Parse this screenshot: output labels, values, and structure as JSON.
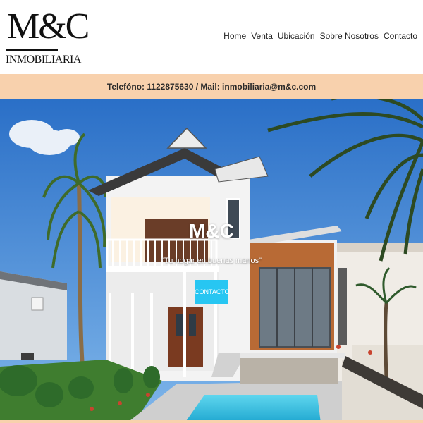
{
  "logo": {
    "mark": "M&C",
    "subtitle": "INMOBILIARIA"
  },
  "nav": {
    "items": [
      "Home",
      "Venta",
      "Ubicación",
      "Sobre Nosotros",
      "Contacto"
    ]
  },
  "infobar": {
    "text": "Telefóno: 1122875630 / Mail: inmobiliaria@m&c.com"
  },
  "hero": {
    "title": "M&C",
    "tagline": "\"Tu hogar en buenas manos\"",
    "button_label": "CONTACTO"
  },
  "colors": {
    "infobar_bg": "#f8d1ad",
    "button_bg": "#27c6f2",
    "sky": "#2e7ad1",
    "text_dark": "#111111"
  },
  "icons": [
    "palm-tree-illustration",
    "house-illustration",
    "pool-illustration"
  ]
}
